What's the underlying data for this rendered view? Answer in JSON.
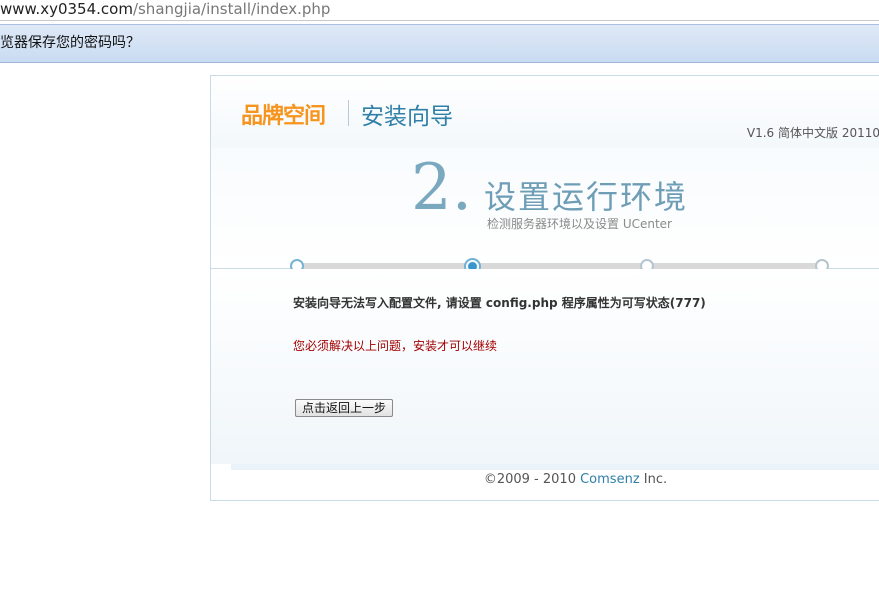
{
  "browser": {
    "url_host": "www.xy0354.com",
    "url_path": "/shangjia/install/index.php",
    "notification": "览器保存您的密码吗？"
  },
  "installer": {
    "brand": "品牌空间",
    "title": "安装向导",
    "version": "V1.6 简体中文版 20110",
    "step": {
      "number": "2.",
      "title": "设置运行环境",
      "subtitle": "检测服务器环境以及设置 UCenter"
    },
    "progress": {
      "total_steps": 4,
      "current_step": 2
    },
    "message_main": "安装向导无法写入配置文件, 请设置 config.php 程序属性为可写状态(777)",
    "message_error": "您必须解决以上问题，安装才可以继续",
    "back_button": "点击返回上一步",
    "footer": {
      "prefix": "©2009 - 2010 ",
      "company": "Comsenz",
      "suffix": " Inc."
    }
  }
}
